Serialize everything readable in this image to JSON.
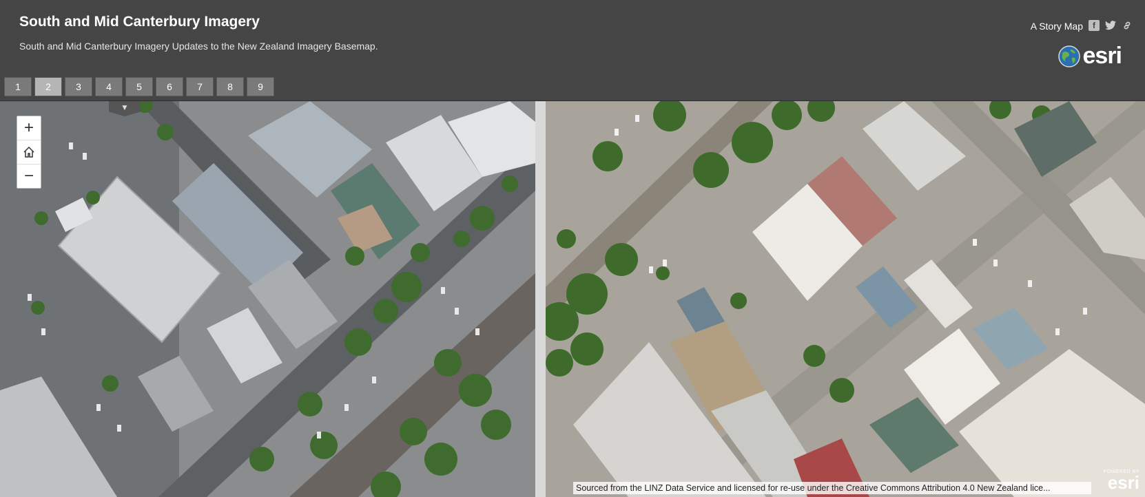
{
  "header": {
    "title": "South and Mid Canterbury Imagery",
    "subtitle": "South and Mid Canterbury Imagery Updates to the New Zealand Imagery Basemap.",
    "storymap_label": "A Story Map",
    "share_icons": [
      "facebook-icon",
      "twitter-icon",
      "link-icon"
    ],
    "logo_text": "esri"
  },
  "tabs": [
    {
      "label": "1",
      "active": false
    },
    {
      "label": "2",
      "active": true
    },
    {
      "label": "3",
      "active": false
    },
    {
      "label": "4",
      "active": false
    },
    {
      "label": "5",
      "active": false
    },
    {
      "label": "6",
      "active": false
    },
    {
      "label": "7",
      "active": false
    },
    {
      "label": "8",
      "active": false
    },
    {
      "label": "9",
      "active": false
    }
  ],
  "map": {
    "zoom_in": "+",
    "home": "home-icon",
    "zoom_out": "−",
    "attribution": "Sourced from the LINZ Data Service and licensed for re-use under the Creative Commons Attribution 4.0 New Zealand lice...",
    "powered_by": "POWERED BY",
    "powered_logo": "esri"
  },
  "colors": {
    "header_bg": "#454545",
    "tab_bg": "#7a7a7a",
    "tab_active_bg": "#b5b5b5"
  }
}
